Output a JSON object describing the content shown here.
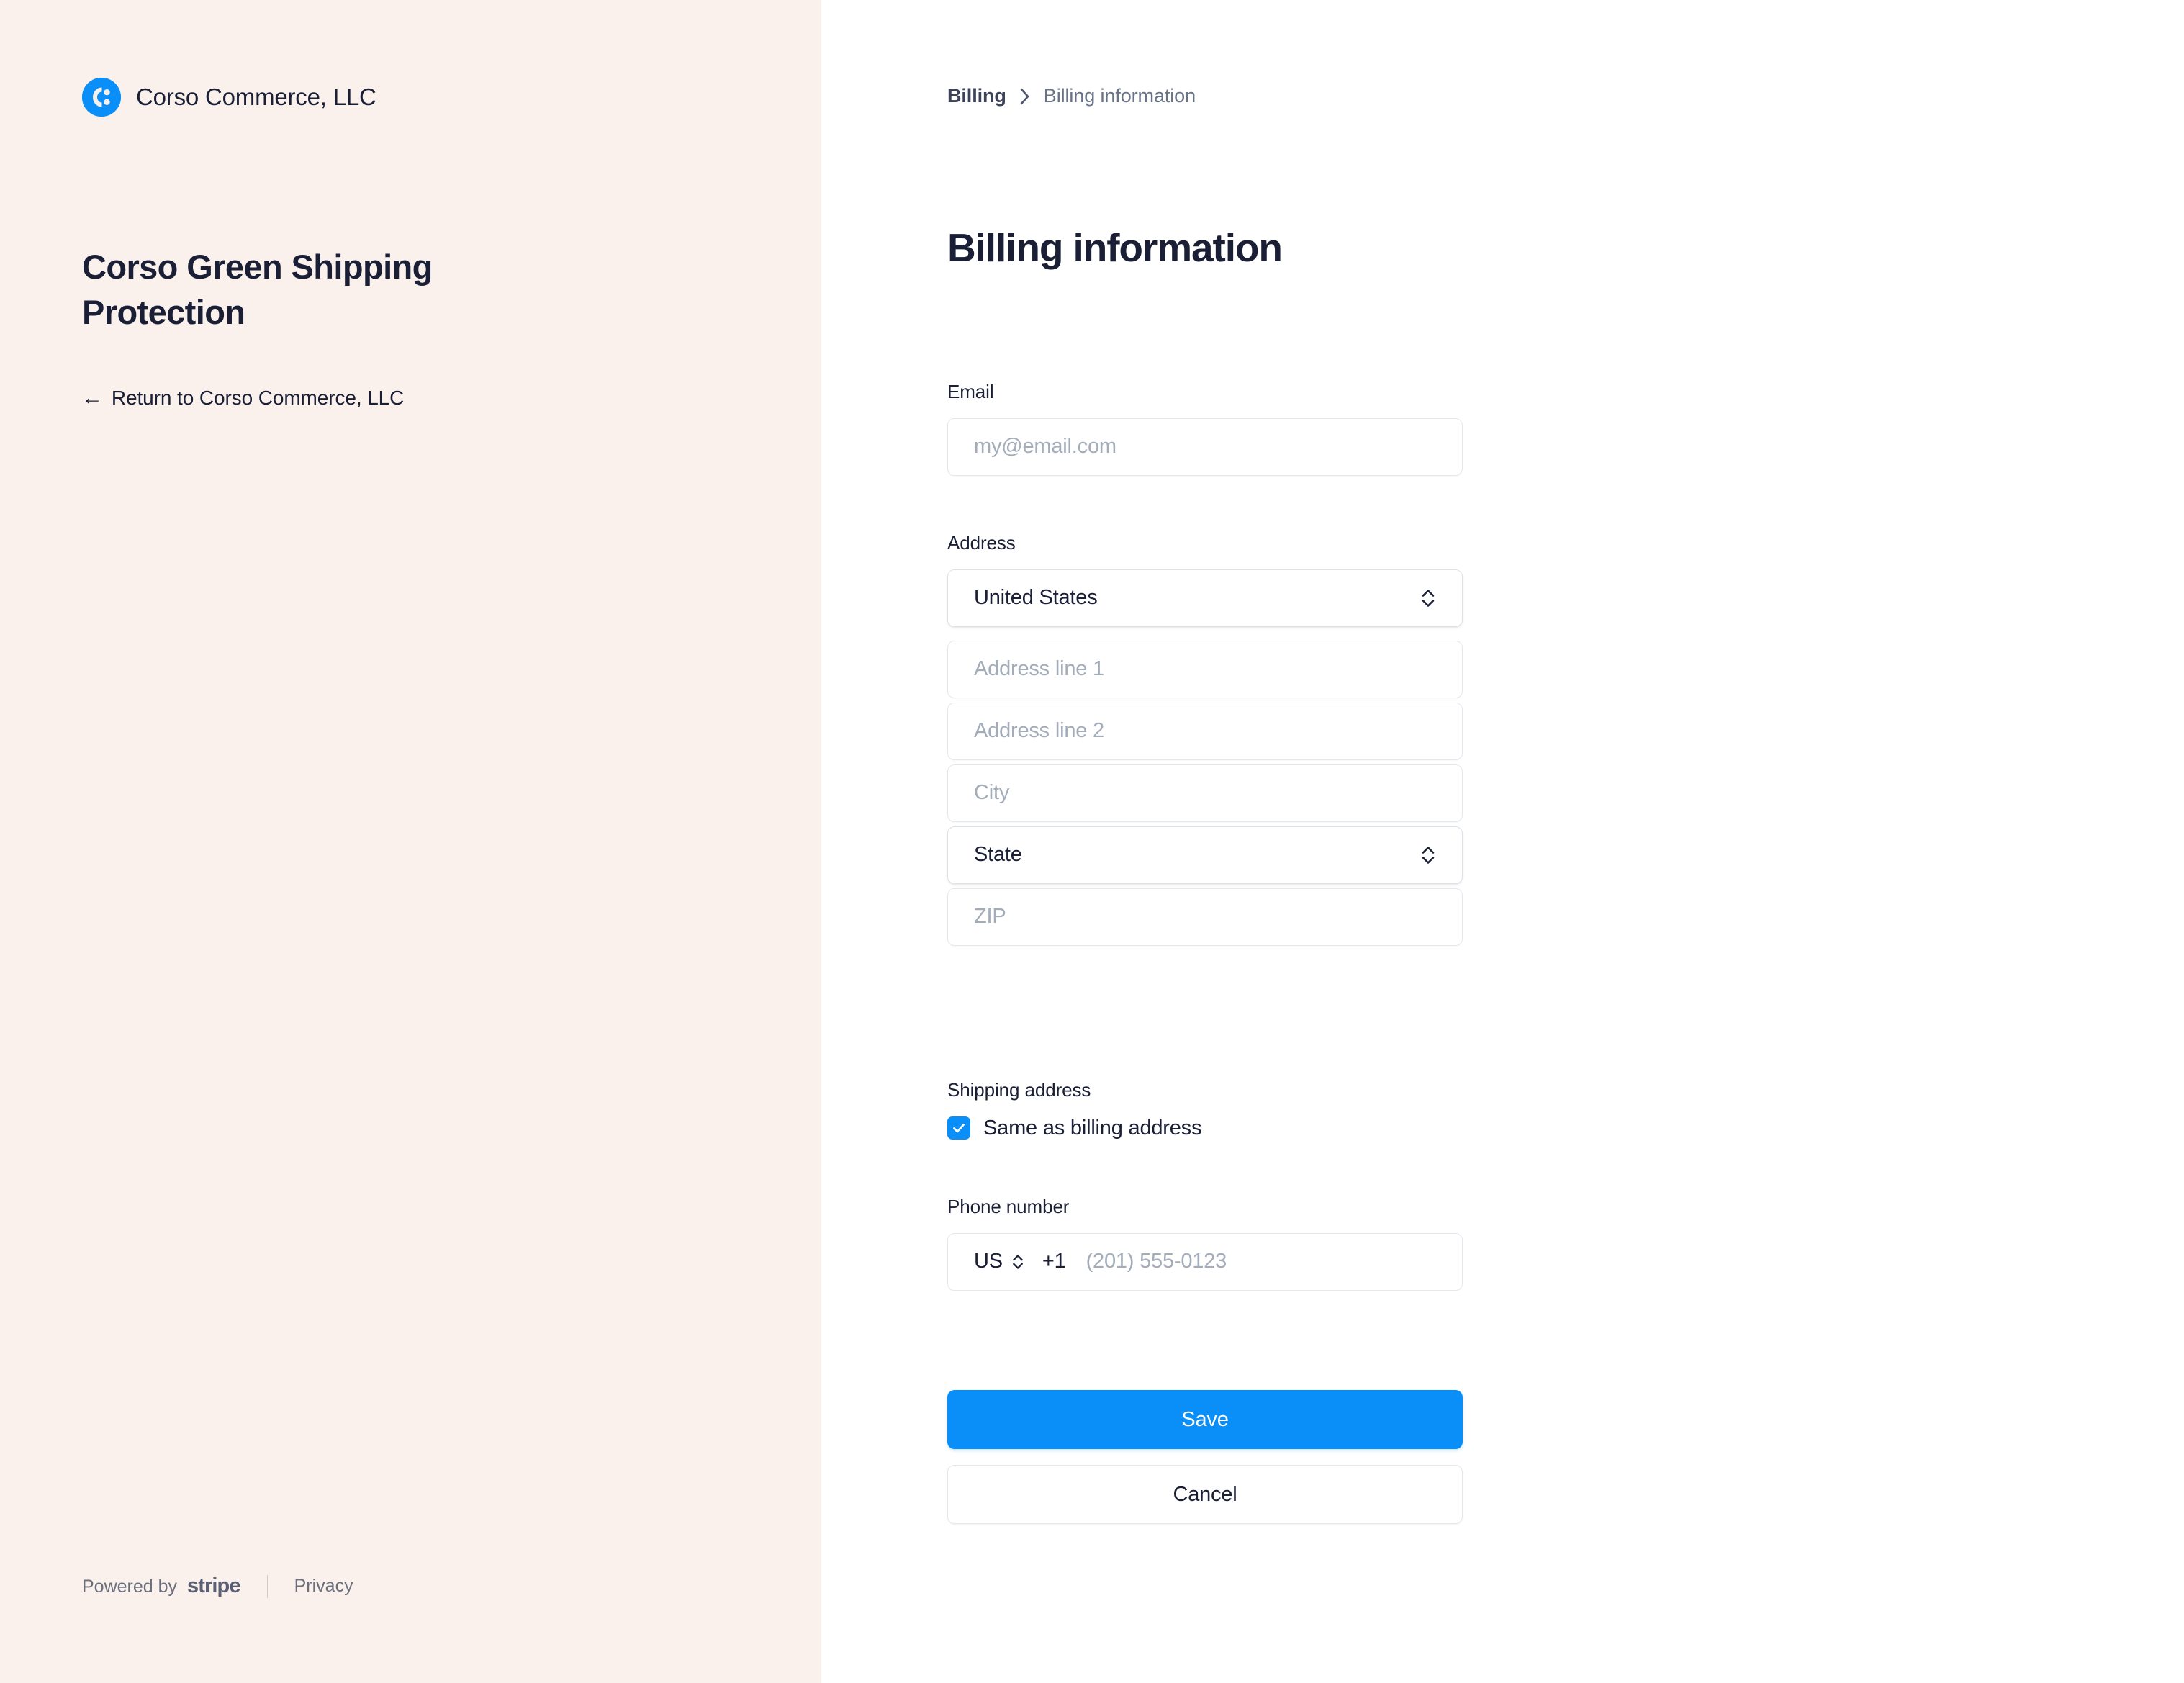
{
  "sidebar": {
    "brand_name": "Corso Commerce, LLC",
    "logo_icon": "corso-logo-icon",
    "product_title": "Corso Green Shipping Protection",
    "return_link": "Return to Corso Commerce, LLC",
    "return_arrow_icon": "arrow-left-icon",
    "footer": {
      "powered_by_label": "Powered by",
      "stripe_wordmark": "stripe",
      "privacy_label": "Privacy"
    },
    "background_color": "#faf1ed"
  },
  "breadcrumb": {
    "root": "Billing",
    "separator_icon": "chevron-right-icon",
    "current": "Billing information"
  },
  "main": {
    "page_title": "Billing information",
    "email": {
      "label": "Email",
      "value": "",
      "placeholder": "my@email.com"
    },
    "address": {
      "label": "Address",
      "country": {
        "value": "United States",
        "icon": "chevron-up-down-icon"
      },
      "line1": {
        "value": "",
        "placeholder": "Address line 1"
      },
      "line2": {
        "value": "",
        "placeholder": "Address line 2"
      },
      "city": {
        "value": "",
        "placeholder": "City"
      },
      "state": {
        "value": "State",
        "icon": "chevron-up-down-icon"
      },
      "zip": {
        "value": "",
        "placeholder": "ZIP"
      }
    },
    "shipping": {
      "label": "Shipping address",
      "checkbox_label": "Same as billing address",
      "checkbox_checked": true,
      "check_icon": "checkmark-icon"
    },
    "phone": {
      "label": "Phone number",
      "country_code": "US",
      "country_icon": "chevron-up-down-icon",
      "dial_code": "+1",
      "value": "",
      "placeholder": "(201) 555-0123"
    },
    "actions": {
      "save_label": "Save",
      "cancel_label": "Cancel"
    }
  },
  "colors": {
    "accent_blue": "#0a8ef7",
    "sidebar_bg": "#faf1ed",
    "text_dark": "#1a1f36",
    "text_muted": "#697386",
    "placeholder": "#a3acb9",
    "border": "#e3e8ee"
  }
}
